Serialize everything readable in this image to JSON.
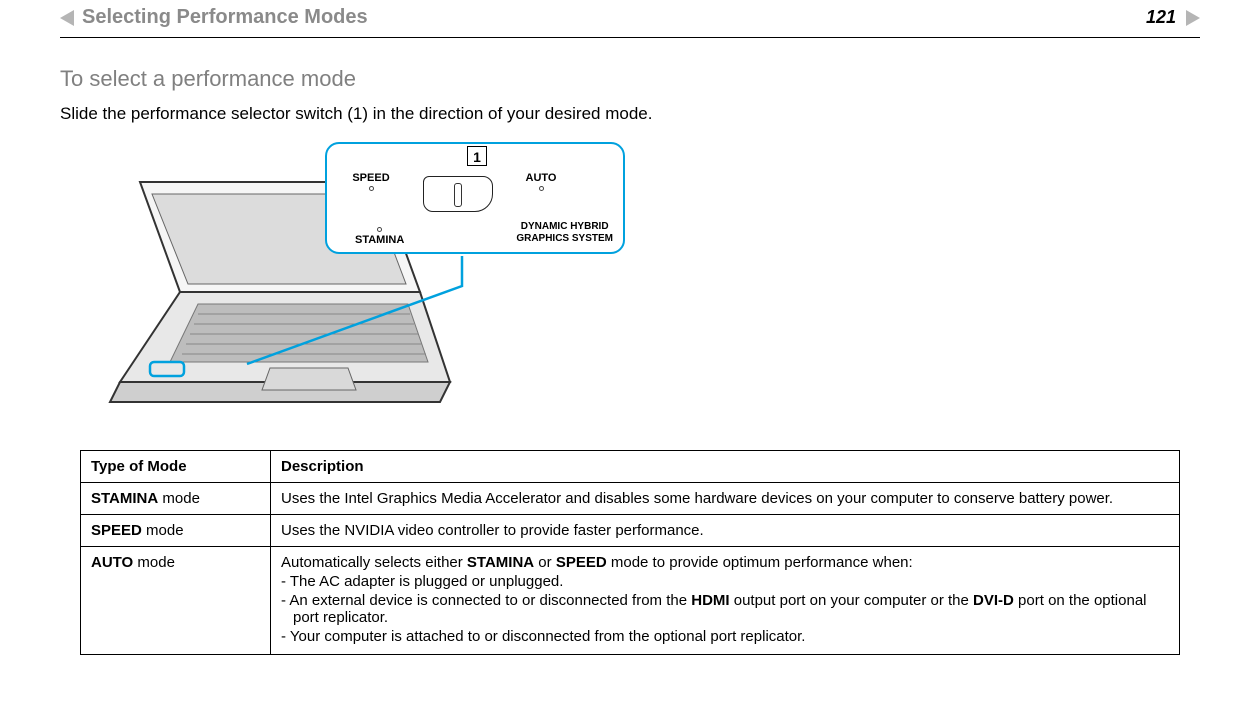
{
  "header": {
    "breadcrumb": "Selecting Performance Modes",
    "page_number": "121"
  },
  "section": {
    "title": "To select a performance mode",
    "intro": "Slide the performance selector switch (1) in the direction of your desired mode."
  },
  "callout": {
    "label": "1",
    "speed": "SPEED",
    "auto": "AUTO",
    "stamina": "STAMINA",
    "system_line1": "DYNAMIC HYBRID",
    "system_line2": "GRAPHICS SYSTEM"
  },
  "table": {
    "headers": {
      "col1": "Type of Mode",
      "col2": "Description"
    },
    "rows": [
      {
        "mode_bold": "STAMINA",
        "mode_suffix": " mode",
        "desc_plain": "Uses the Intel Graphics Media Accelerator and disables some hardware devices on your computer to conserve battery power."
      },
      {
        "mode_bold": "SPEED",
        "mode_suffix": " mode",
        "desc_plain": "Uses the NVIDIA video controller to provide faster performance."
      },
      {
        "mode_bold": "AUTO",
        "mode_suffix": " mode",
        "auto_intro_pre": "Automatically selects either ",
        "auto_intro_b1": "STAMINA",
        "auto_intro_mid": " or ",
        "auto_intro_b2": "SPEED",
        "auto_intro_post": " mode to provide optimum performance when:",
        "bullets": {
          "b1": "- The AC adapter is plugged or unplugged.",
          "b2_pre": "- An external device is connected to or disconnected from the ",
          "b2_bold1": "HDMI",
          "b2_mid": " output port on your computer or the ",
          "b2_bold2": "DVI-D",
          "b2_post": " port on the optional port replicator.",
          "b3": "- Your computer is attached to or disconnected from the optional port replicator."
        }
      }
    ]
  }
}
